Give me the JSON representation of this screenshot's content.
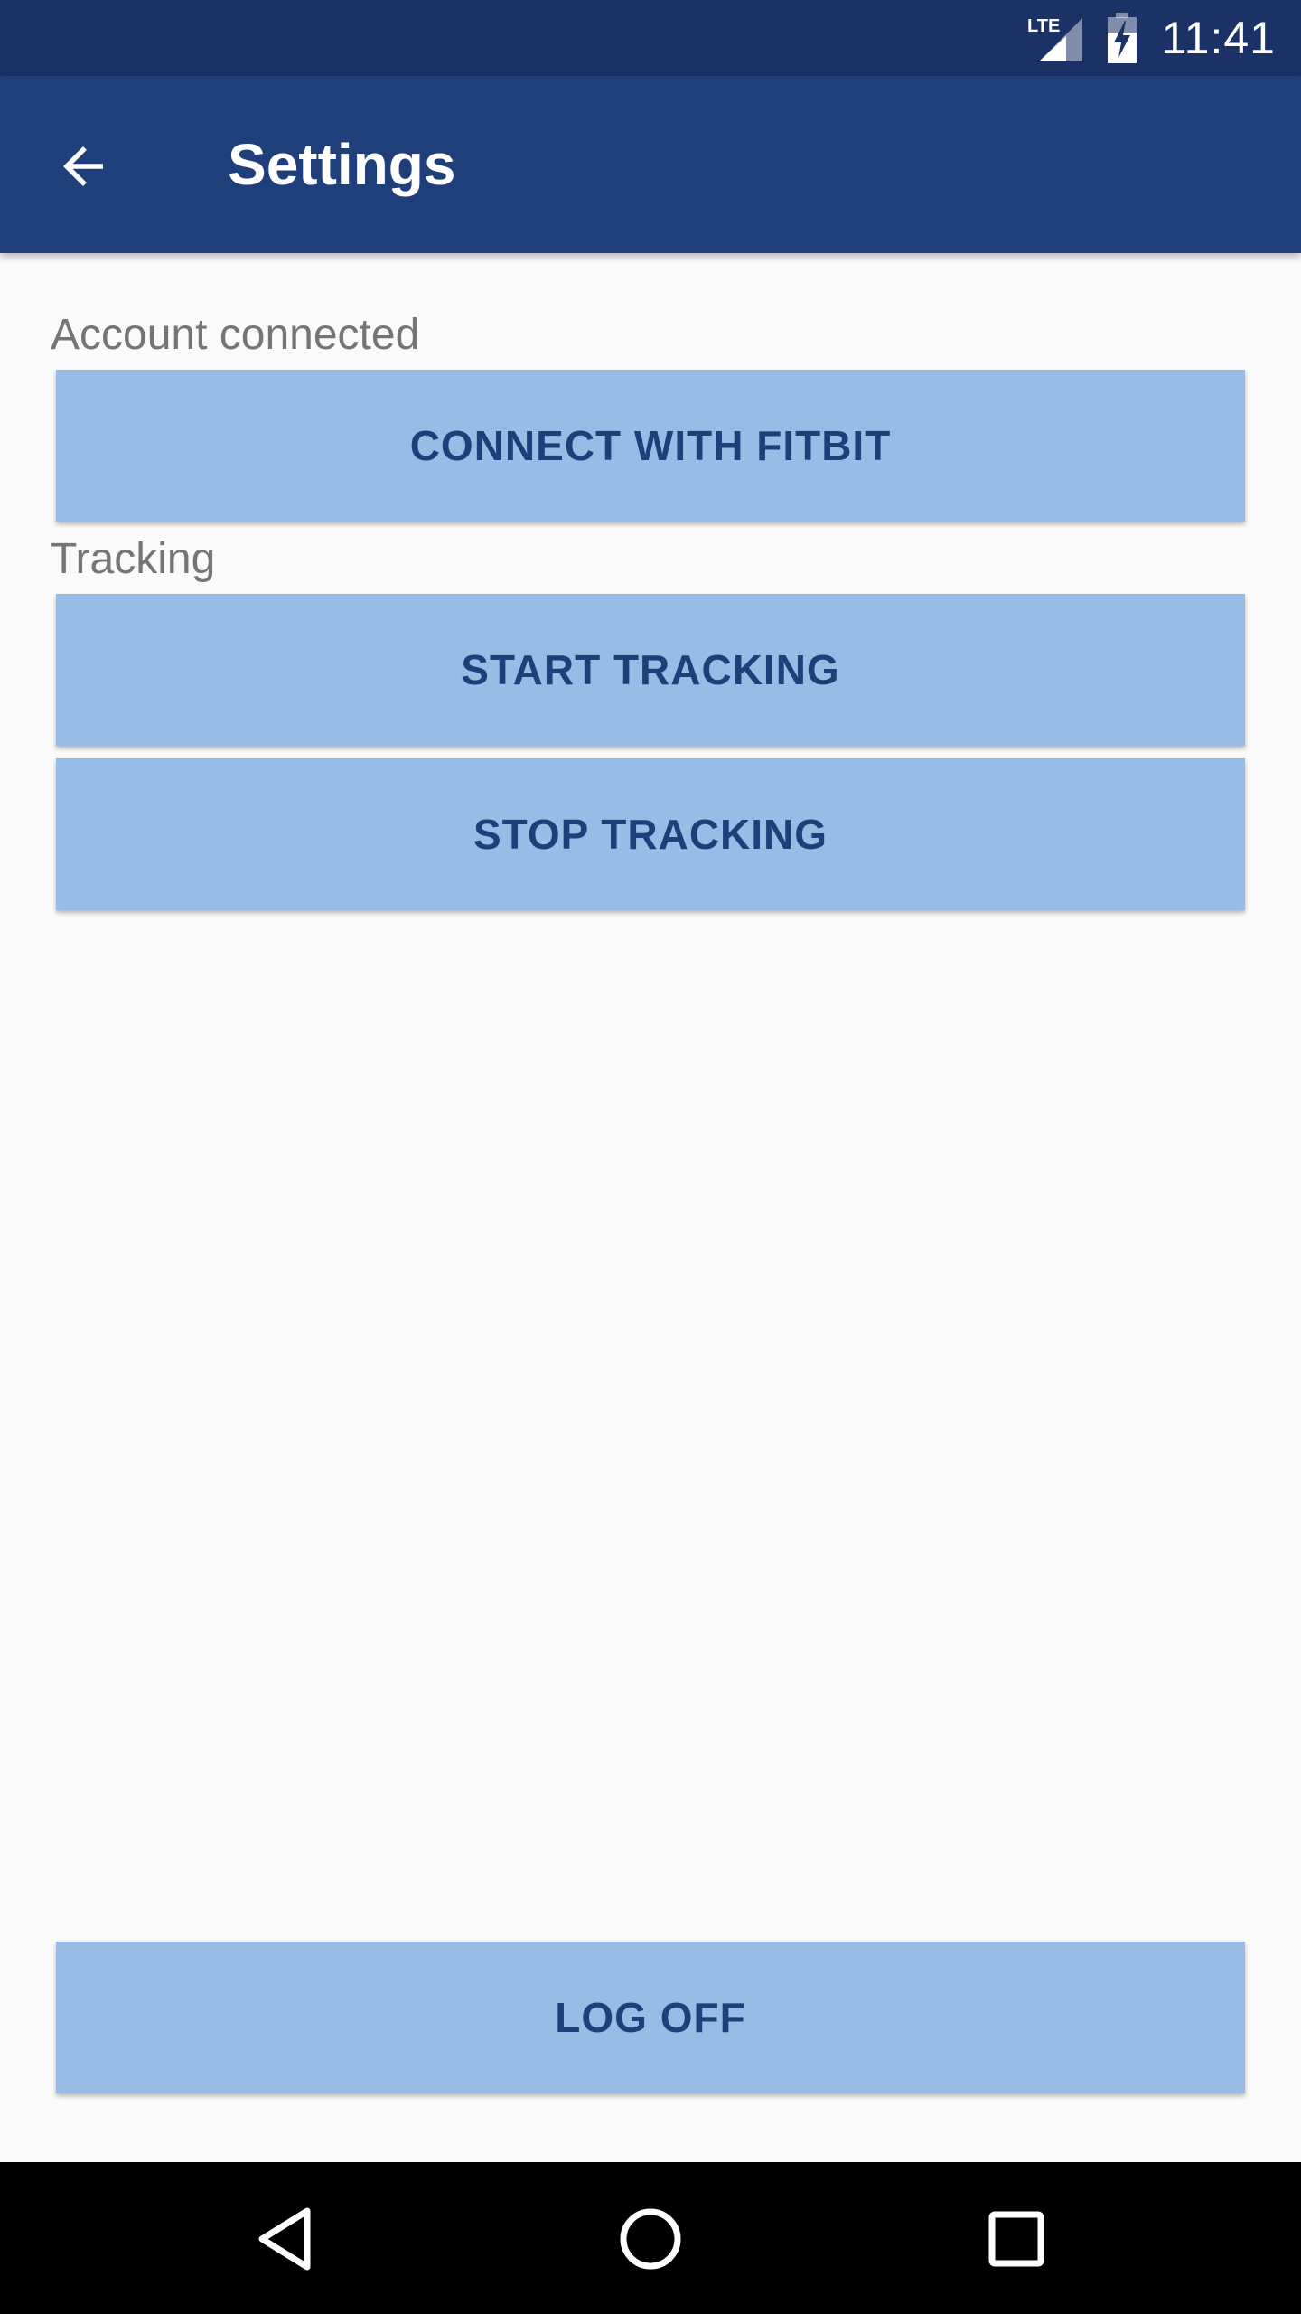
{
  "status_bar": {
    "network": "LTE",
    "time": "11:41",
    "icons": [
      "lte-signal-icon",
      "battery-charging-icon"
    ]
  },
  "app_bar": {
    "title": "Settings",
    "back_icon": "arrow-back-icon"
  },
  "account_section": {
    "label": "Account connected",
    "button_label": "CONNECT WITH FITBIT"
  },
  "tracking_section": {
    "label": "Tracking",
    "start_label": "START TRACKING",
    "stop_label": "STOP TRACKING"
  },
  "logoff": {
    "label": "LOG OFF"
  },
  "nav_bar": {
    "icons": [
      "back-triangle-icon",
      "home-circle-icon",
      "recents-square-icon"
    ]
  },
  "colors": {
    "status_bar": "#1a3266",
    "app_bar": "#1f3f7b",
    "button_bg": "#97bce6",
    "button_text": "#1f3f7b",
    "background": "#fafafa",
    "label_text": "#757575"
  }
}
